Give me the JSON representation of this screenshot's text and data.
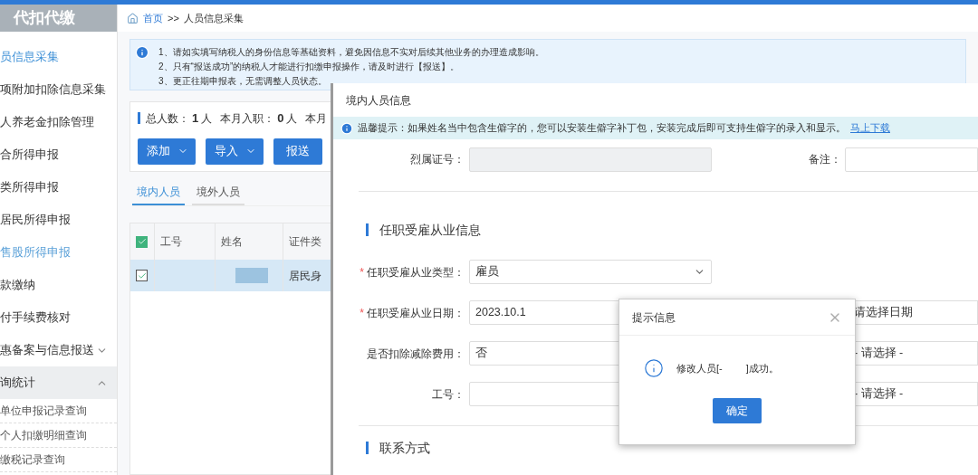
{
  "sidebar": {
    "title": "代扣代缴",
    "items": [
      {
        "kind": "link",
        "label": "员信息采集",
        "selected": true,
        "highlighted": false
      },
      {
        "kind": "link",
        "label": "项附加扣除信息采集",
        "selected": false,
        "highlighted": false
      },
      {
        "kind": "link",
        "label": "人养老金扣除管理",
        "selected": false,
        "highlighted": false
      },
      {
        "kind": "link",
        "label": "合所得申报",
        "selected": false,
        "highlighted": false
      },
      {
        "kind": "link",
        "label": "类所得申报",
        "selected": false,
        "highlighted": false
      },
      {
        "kind": "link",
        "label": "居民所得申报",
        "selected": false,
        "highlighted": false
      },
      {
        "kind": "link",
        "label": "售股所得申报",
        "selected": false,
        "highlighted": true
      },
      {
        "kind": "link",
        "label": "款缴纳",
        "selected": false,
        "highlighted": false
      },
      {
        "kind": "link",
        "label": "付手续费核对",
        "selected": false,
        "highlighted": false
      },
      {
        "kind": "group",
        "label": "惠备案与信息报送",
        "expanded": false
      },
      {
        "kind": "group",
        "label": "询统计",
        "expanded": true,
        "children": [
          {
            "label": "单位申报记录查询"
          },
          {
            "label": "个人扣缴明细查询"
          },
          {
            "label": "缴税记录查询"
          }
        ]
      }
    ]
  },
  "breadcrumb": {
    "home": "首页",
    "separator": ">>",
    "current": "人员信息采集"
  },
  "notice": [
    "1、请如实填写纳税人的身份信息等基础资料，避免因信息不实对后续其他业务的办理造成影响。",
    "2、只有“报送成功”的纳税人才能进行扣缴申报操作，请及时进行【报送】。",
    "3、更正往期申报表，无需调整人员状态。"
  ],
  "stats": [
    {
      "label": "总人数：",
      "value": "1",
      "unit": "人"
    },
    {
      "label": "本月入职：",
      "value": "0",
      "unit": "人"
    },
    {
      "label": "本月"
    }
  ],
  "actions": [
    {
      "label": "添加",
      "dropdown": true
    },
    {
      "label": "导入",
      "dropdown": true
    },
    {
      "label": "报送",
      "dropdown": false
    }
  ],
  "tabs": [
    {
      "label": "境内人员",
      "selected": true
    },
    {
      "label": "境外人员",
      "selected": false
    }
  ],
  "table": {
    "all_checked": true,
    "columns": [
      "工号",
      "姓名",
      "证件类"
    ],
    "rows": [
      {
        "checked": true,
        "selected": true,
        "cells": [
          "",
          "",
          "居民身"
        ]
      }
    ]
  },
  "dialog": {
    "title": "境内人员信息",
    "tip": "温馨提示：如果姓名当中包含生僻字的，您可以安装生僻字补丁包，安装完成后即可支持生僻字的录入和显示。",
    "tip_link": "马上下载",
    "top_fields": [
      {
        "label": "烈属证号：",
        "disabled": true
      },
      {
        "label": "备注：",
        "disabled": false
      }
    ],
    "section1": "任职受雇从业信息",
    "rows": [
      {
        "label": "任职受雇从业类型：",
        "required_mark": "*",
        "kind": "select",
        "value": "雇员"
      },
      {
        "label": "任职受雇从业日期：",
        "required_mark": "*",
        "kind": "input",
        "value": "2023.10.1",
        "right": "请选择日期"
      },
      {
        "label": "是否扣除减除费用：",
        "kind": "input",
        "value": "否",
        "right": "- 请选择 -"
      },
      {
        "label": "工号：",
        "kind": "input",
        "value": "",
        "right": "- 请选择 -"
      }
    ],
    "section2": "联系方式"
  },
  "alert": {
    "title": "提示信息",
    "message_before": "修改人员[-",
    "message_after": "]成功。",
    "ok": "确定"
  }
}
